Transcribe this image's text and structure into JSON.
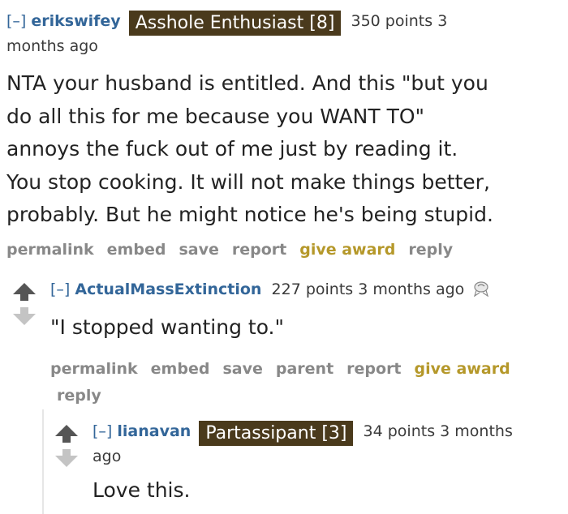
{
  "comments": [
    {
      "toggle": "[–]",
      "author": "erikswifey",
      "flair": "Asshole Enthusiast [8]",
      "score": "350 points",
      "time_a": "3",
      "time_b": "months ago",
      "body": [
        "NTA your husband is entitled. And this \"but you",
        "do all this for me because you WANT TO\"",
        "annoys the fuck out of me just by reading it.",
        "You stop cooking. It will not make things better,",
        "probably. But he might notice he's being stupid."
      ],
      "actions": {
        "permalink": "permalink",
        "embed": "embed",
        "save": "save",
        "report": "report",
        "give_award": "give award",
        "reply": "reply"
      }
    },
    {
      "toggle": "[–]",
      "author": "ActualMassExtinction",
      "score": "227 points",
      "time": "3 months ago",
      "award_icon": "award-icon",
      "body": "\"I stopped wanting to.\"",
      "actions": {
        "permalink": "permalink",
        "embed": "embed",
        "save": "save",
        "parent": "parent",
        "report": "report",
        "give_award": "give award",
        "reply": "reply"
      }
    },
    {
      "toggle": "[–]",
      "author": "lianavan",
      "flair": "Partassipant [3]",
      "score": "34 points",
      "time_a": "3 months",
      "time_b": "ago",
      "body": "Love this."
    }
  ],
  "colors": {
    "author": "#336699",
    "flair_bg": "#4a3a1c",
    "action_gray": "#888888",
    "award_gold": "#b5982a",
    "upvote": "#555555",
    "downvote": "#c4c4c4"
  }
}
